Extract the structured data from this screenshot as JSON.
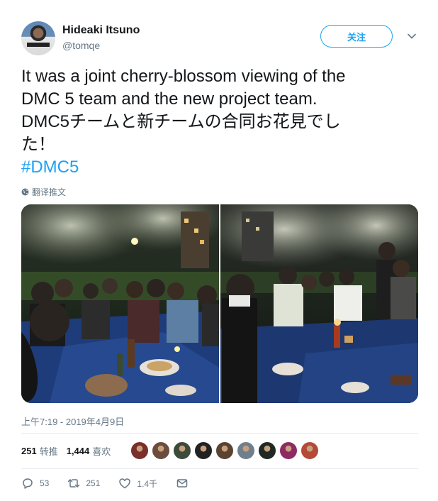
{
  "author": {
    "display_name": "Hideaki Itsuno",
    "handle": "@tomqe"
  },
  "follow_label": "关注",
  "tweet": {
    "text_lines": [
      "It was a joint cherry-blossom viewing of the",
      "DMC 5 team and the new project team.",
      "DMC5チームと新チームの合同お花見でし",
      "た！"
    ],
    "hashtag": "#DMC5",
    "translate_label": "翻译推文",
    "timestamp": "上午7:19 - 2019年4月9日"
  },
  "stats": {
    "retweets_count": "251",
    "retweets_label": "转推",
    "likes_count": "1,444",
    "likes_label": "喜欢"
  },
  "actions": {
    "reply_count": "53",
    "retweet_count": "251",
    "like_count": "1.4千"
  },
  "icons": {
    "follow": "follow-button",
    "caret": "chevron-down-icon",
    "translate": "globe-icon",
    "reply": "reply-icon",
    "retweet": "retweet-icon",
    "like": "heart-icon",
    "dm": "message-icon"
  },
  "colors": {
    "accent": "#1da1f2",
    "text": "#14171a",
    "muted": "#657786"
  },
  "liker_colors": [
    "#7a2f2a",
    "#6b4d3f",
    "#3d4b3a",
    "#222222",
    "#5a4330",
    "#6f7f8c",
    "#1f2a24",
    "#8e2b65",
    "#b44a38"
  ]
}
